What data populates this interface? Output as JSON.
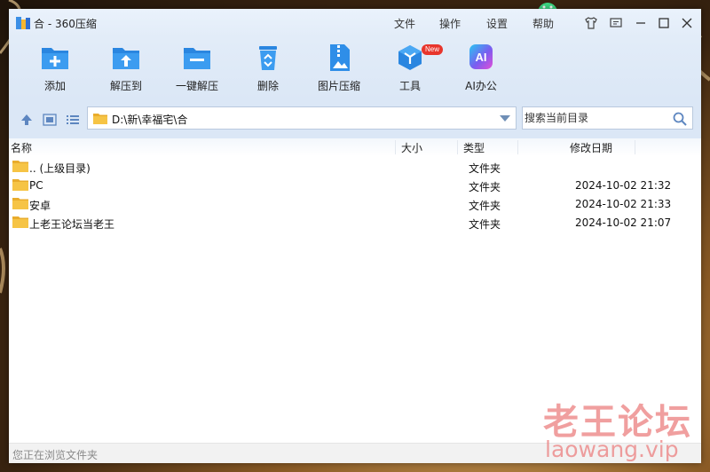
{
  "window": {
    "title": "合 - 360压缩",
    "menu": [
      "文件",
      "操作",
      "设置",
      "帮助"
    ]
  },
  "toolbar": {
    "buttons": [
      {
        "label": "添加",
        "icon": "add-folder-icon"
      },
      {
        "label": "解压到",
        "icon": "extract-to-icon"
      },
      {
        "label": "一键解压",
        "icon": "one-click-extract-icon"
      },
      {
        "label": "删除",
        "icon": "recycle-bin-icon"
      },
      {
        "label": "图片压缩",
        "icon": "image-compress-icon"
      },
      {
        "label": "工具",
        "icon": "tools-cube-icon",
        "badge": "New"
      },
      {
        "label": "AI办公",
        "icon": "ai-office-icon",
        "icon_text": "AI"
      }
    ]
  },
  "address": {
    "path": "D:\\新\\幸福宅\\合",
    "search_placeholder": "搜索当前目录"
  },
  "list": {
    "columns": {
      "name": "名称",
      "size": "大小",
      "type": "类型",
      "modified": "修改日期"
    },
    "rows": [
      {
        "name": ".. (上级目录)",
        "size": "",
        "type": "文件夹",
        "modified": ""
      },
      {
        "name": "PC",
        "size": "",
        "type": "文件夹",
        "modified": "2024-10-02 21:32"
      },
      {
        "name": "安卓",
        "size": "",
        "type": "文件夹",
        "modified": "2024-10-02 21:33"
      },
      {
        "name": "上老王论坛当老王",
        "size": "",
        "type": "文件夹",
        "modified": "2024-10-02 21:07"
      }
    ]
  },
  "status": {
    "text": "您正在浏览文件夹"
  },
  "watermark": {
    "title": "老王论坛",
    "domain": "laowang.vip"
  },
  "colors": {
    "accent": "#1e88e5",
    "toolbar_bg": "#dbe7f6",
    "folder": "#f6c445",
    "badge": "#e8352c",
    "watermark": "#ec8484"
  }
}
